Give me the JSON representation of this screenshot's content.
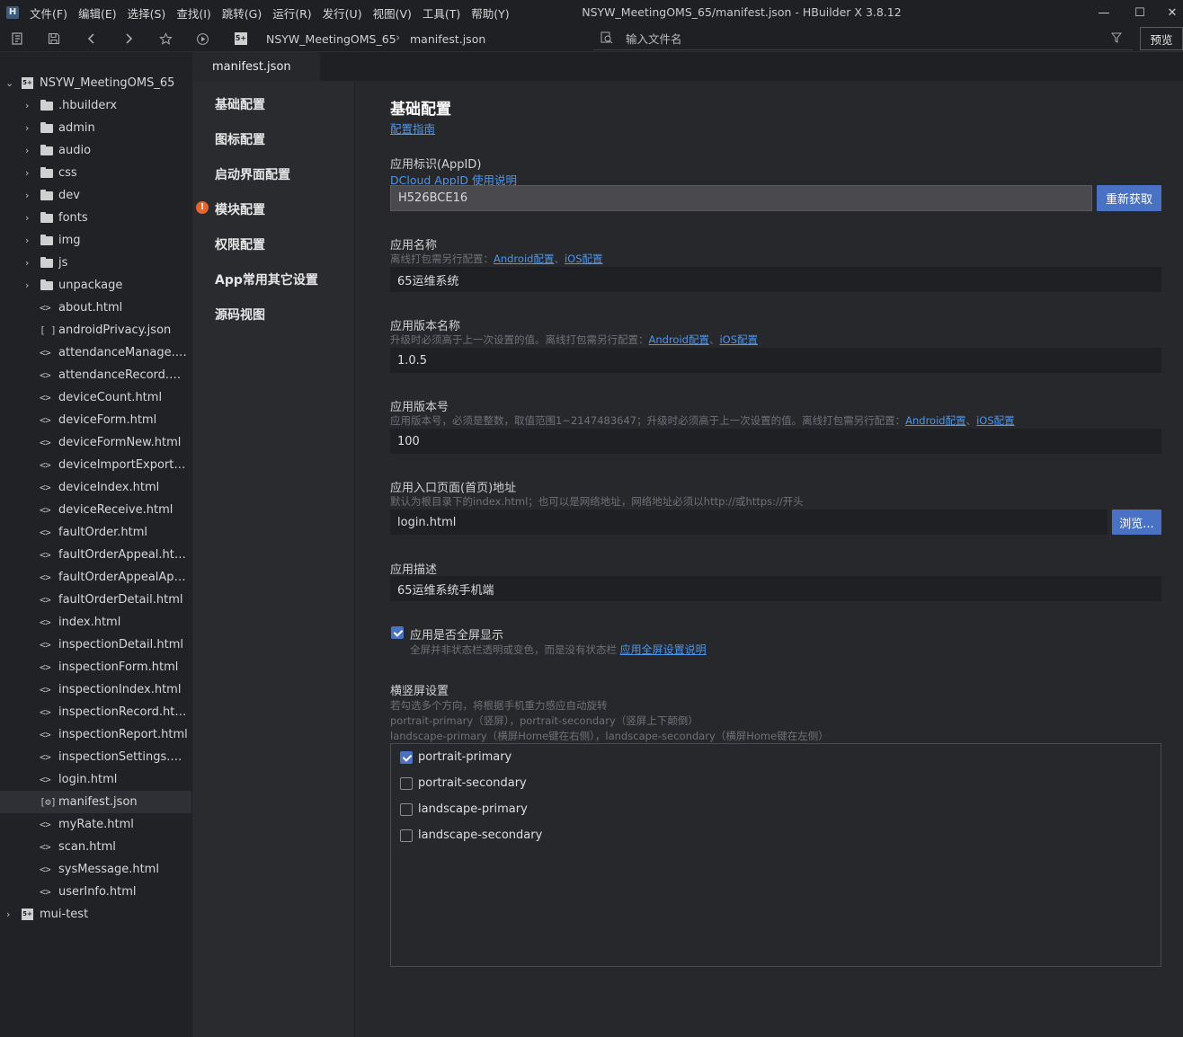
{
  "app": {
    "logo": "H",
    "window_title": "NSYW_MeetingOMS_65/manifest.json - HBuilder X 3.8.12",
    "menus": [
      "文件(F)",
      "编辑(E)",
      "选择(S)",
      "查找(I)",
      "跳转(G)",
      "运行(R)",
      "发行(U)",
      "视图(V)",
      "工具(T)",
      "帮助(Y)"
    ],
    "window_controls": {
      "minimize": "—",
      "maximize": "☐",
      "close": "✕"
    }
  },
  "toolbar": {
    "icons": [
      "outline-icon",
      "save-icon",
      "back-icon",
      "forward-icon",
      "favorite-icon",
      "run-icon"
    ],
    "breadcrumb": {
      "project_badge": "5+",
      "project": "NSYW_MeetingOMS_65",
      "separator": "›",
      "file": "manifest.json"
    },
    "search": {
      "placeholder": "输入文件名"
    },
    "preview_label": "预览"
  },
  "sidebar": {
    "root": {
      "label": "NSYW_MeetingOMS_65",
      "badge": "5+"
    },
    "folders": [
      ".hbuilderx",
      "admin",
      "audio",
      "css",
      "dev",
      "fonts",
      "img",
      "js",
      "unpackage"
    ],
    "files": [
      {
        "icon": "<>",
        "label": "about.html"
      },
      {
        "icon": "[ ]",
        "label": "androidPrivacy.json"
      },
      {
        "icon": "<>",
        "label": "attendanceManage.html"
      },
      {
        "icon": "<>",
        "label": "attendanceRecord.html"
      },
      {
        "icon": "<>",
        "label": "deviceCount.html"
      },
      {
        "icon": "<>",
        "label": "deviceForm.html"
      },
      {
        "icon": "<>",
        "label": "deviceFormNew.html"
      },
      {
        "icon": "<>",
        "label": "deviceImportExport.ht..."
      },
      {
        "icon": "<>",
        "label": "deviceIndex.html"
      },
      {
        "icon": "<>",
        "label": "deviceReceive.html"
      },
      {
        "icon": "<>",
        "label": "faultOrder.html"
      },
      {
        "icon": "<>",
        "label": "faultOrderAppeal.html"
      },
      {
        "icon": "<>",
        "label": "faultOrderAppealAppl..."
      },
      {
        "icon": "<>",
        "label": "faultOrderDetail.html"
      },
      {
        "icon": "<>",
        "label": "index.html"
      },
      {
        "icon": "<>",
        "label": "inspectionDetail.html"
      },
      {
        "icon": "<>",
        "label": "inspectionForm.html"
      },
      {
        "icon": "<>",
        "label": "inspectionIndex.html"
      },
      {
        "icon": "<>",
        "label": "inspectionRecord.html"
      },
      {
        "icon": "<>",
        "label": "inspectionReport.html"
      },
      {
        "icon": "<>",
        "label": "inspectionSettings.html"
      },
      {
        "icon": "<>",
        "label": "login.html"
      },
      {
        "icon": "[⚙]",
        "label": "manifest.json",
        "active": true
      },
      {
        "icon": "<>",
        "label": "myRate.html"
      },
      {
        "icon": "<>",
        "label": "scan.html"
      },
      {
        "icon": "<>",
        "label": "sysMessage.html"
      },
      {
        "icon": "<>",
        "label": "userInfo.html"
      }
    ],
    "other_project": {
      "label": "mui-test",
      "badge": "5+"
    }
  },
  "editor": {
    "tab_label": "manifest.json",
    "nav": [
      {
        "label": "基础配置"
      },
      {
        "label": "图标配置"
      },
      {
        "label": "启动界面配置"
      },
      {
        "label": "模块配置",
        "warning": "!"
      },
      {
        "label": "权限配置"
      },
      {
        "label": "App常用其它设置"
      },
      {
        "label": "源码视图"
      }
    ]
  },
  "content": {
    "title": "基础配置",
    "guide_link": "配置指南",
    "appid": {
      "title": "应用标识(AppID)",
      "link": "DCloud AppID 使用说明",
      "value": "H526BCE16",
      "button": "重新获取"
    },
    "app_name": {
      "title": "应用名称",
      "hint_prefix": "离线打包需另行配置：",
      "link_android": "Android配置",
      "sep": "、",
      "link_ios": "iOS配置",
      "value": "65运维系统"
    },
    "version_name": {
      "title": "应用版本名称",
      "hint_prefix": "升级时必须高于上一次设置的值。离线打包需另行配置：",
      "link_android": "Android配置",
      "sep": "、",
      "link_ios": "iOS配置",
      "value": "1.0.5"
    },
    "version_code": {
      "title": "应用版本号",
      "hint_prefix": "应用版本号，必须是整数，取值范围1~2147483647；升级时必须高于上一次设置的值。离线打包需另行配置：",
      "link_android": "Android配置",
      "sep": "、",
      "link_ios": "iOS配置",
      "value": "100"
    },
    "entry": {
      "title": "应用入口页面(首页)地址",
      "hint": "默认为根目录下的index.html；也可以是网络地址，网络地址必须以http://或https://开头",
      "value": "login.html",
      "button": "浏览..."
    },
    "description": {
      "title": "应用描述",
      "value": "65运维系统手机端"
    },
    "fullscreen": {
      "label": "应用是否全屏显示",
      "checked": true,
      "hint": "全屏并非状态栏透明或变色，而是没有状态栏",
      "link": "应用全屏设置说明"
    },
    "orientation": {
      "title": "横竖屏设置",
      "hints": [
        "若勾选多个方向，将根据手机重力感应自动旋转",
        "portrait-primary（竖屏），portrait-secondary（竖屏上下颠倒）",
        "landscape-primary（横屏Home键在右侧），landscape-secondary（横屏Home键在左侧）"
      ],
      "options": [
        {
          "label": "portrait-primary",
          "checked": true
        },
        {
          "label": "portrait-secondary",
          "checked": false
        },
        {
          "label": "landscape-primary",
          "checked": false
        },
        {
          "label": "landscape-secondary",
          "checked": false
        }
      ]
    }
  },
  "colors": {
    "accent": "#4a72c4",
    "link": "#4d95ea",
    "warning": "#e8642a"
  }
}
